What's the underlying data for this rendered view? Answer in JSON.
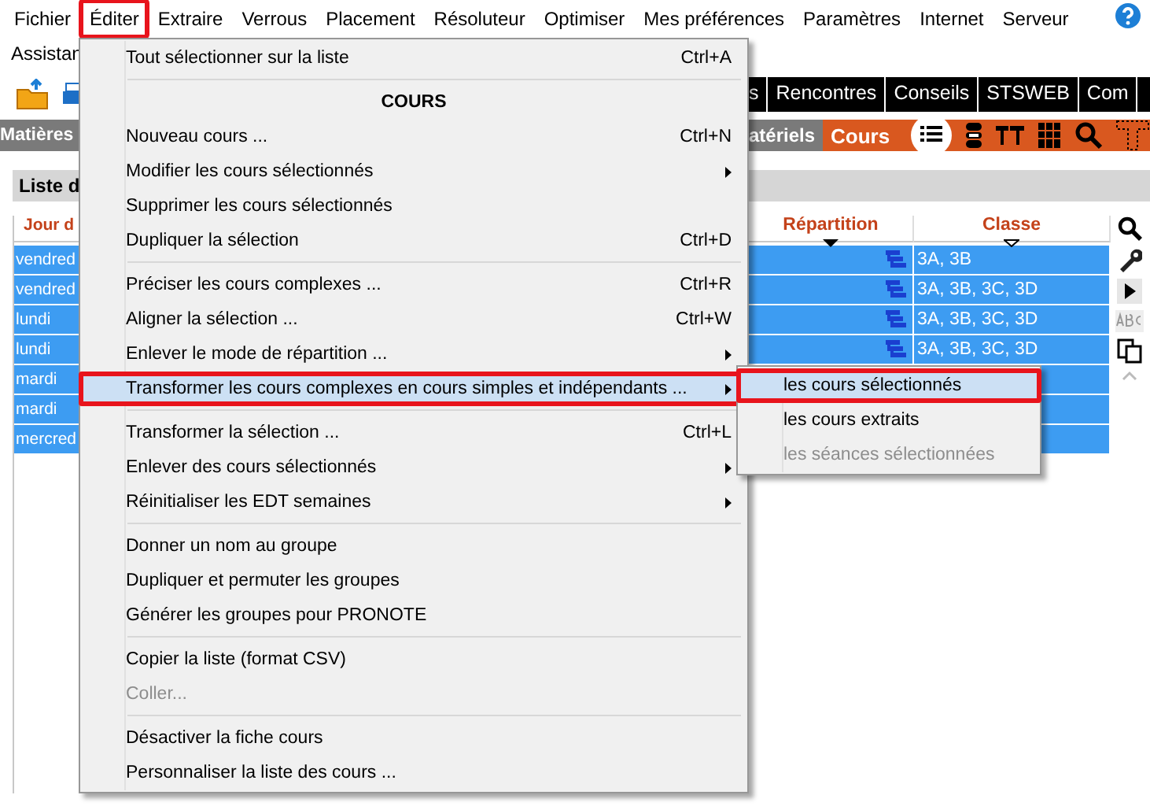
{
  "menubar": [
    {
      "label": "Fichier",
      "selected": false
    },
    {
      "label": "Éditer",
      "selected": true
    },
    {
      "label": "Extraire",
      "selected": false
    },
    {
      "label": "Verrous",
      "selected": false
    },
    {
      "label": "Placement",
      "selected": false
    },
    {
      "label": "Résoluteur",
      "selected": false
    },
    {
      "label": "Optimiser",
      "selected": false
    },
    {
      "label": "Mes préférences",
      "selected": false
    },
    {
      "label": "Paramètres",
      "selected": false
    },
    {
      "label": "Internet",
      "selected": false
    },
    {
      "label": "Serveur",
      "selected": false
    }
  ],
  "menubar_row2": "Assistan",
  "toolbar_tabs": [
    "s",
    "Rencontres",
    "Conseils",
    "STSWEB",
    "Com"
  ],
  "nav_bar": {
    "left": "Matières",
    "items": [
      {
        "label": "atériels",
        "selected": false
      },
      {
        "label": "Cours",
        "selected": true
      }
    ]
  },
  "panel_title": "Liste d",
  "table": {
    "columns": [
      {
        "label": "Jour d",
        "kind": "plain"
      },
      {
        "label": "Répartition",
        "kind": "filled"
      },
      {
        "label": "Classe",
        "kind": "outline"
      }
    ],
    "rows": [
      {
        "day": "vendred",
        "classe": "3A, 3B",
        "selected": true
      },
      {
        "day": "vendred",
        "classe": "3A, 3B, 3C, 3D",
        "selected": true
      },
      {
        "day": "lundi",
        "classe": "3A, 3B, 3C, 3D",
        "selected": true
      },
      {
        "day": "lundi",
        "classe": "3A, 3B, 3C, 3D",
        "selected": true
      },
      {
        "day": "mardi",
        "selected": true
      },
      {
        "day": "mardi",
        "selected": true
      },
      {
        "day": "mercred",
        "selected": true
      }
    ]
  },
  "edit_menu": {
    "items": [
      {
        "kind": "item",
        "label": "Tout sélectionner sur la liste",
        "shortcut": "Ctrl+A",
        "submenu": false,
        "disabled": false,
        "selected": false
      },
      {
        "kind": "separator"
      },
      {
        "kind": "header",
        "label": "COURS"
      },
      {
        "kind": "item",
        "label": "Nouveau cours ...",
        "shortcut": "Ctrl+N",
        "submenu": false,
        "disabled": false,
        "selected": false
      },
      {
        "kind": "item",
        "label": "Modifier les cours sélectionnés",
        "submenu": true,
        "disabled": false,
        "selected": false
      },
      {
        "kind": "item",
        "label": "Supprimer les cours sélectionnés",
        "submenu": false,
        "disabled": false,
        "selected": false
      },
      {
        "kind": "item",
        "label": "Dupliquer la sélection",
        "shortcut": "Ctrl+D",
        "submenu": false,
        "disabled": false,
        "selected": false
      },
      {
        "kind": "separator"
      },
      {
        "kind": "item",
        "label": "Préciser les cours complexes ...",
        "shortcut": "Ctrl+R",
        "submenu": false,
        "disabled": false,
        "selected": false
      },
      {
        "kind": "item",
        "label": "Aligner la sélection ...",
        "shortcut": "Ctrl+W",
        "submenu": false,
        "disabled": false,
        "selected": false
      },
      {
        "kind": "item",
        "label": "Enlever le mode de répartition ...",
        "submenu": true,
        "disabled": false,
        "selected": false
      },
      {
        "kind": "item",
        "label": "Transformer les cours complexes en cours simples et indépendants ...",
        "submenu": true,
        "disabled": false,
        "selected": true
      },
      {
        "kind": "separator"
      },
      {
        "kind": "item",
        "label": "Transformer la sélection ...",
        "shortcut": "Ctrl+L",
        "submenu": false,
        "disabled": false,
        "selected": false
      },
      {
        "kind": "item",
        "label": "Enlever des cours sélectionnés",
        "submenu": true,
        "disabled": false,
        "selected": false
      },
      {
        "kind": "item",
        "label": "Réinitialiser les EDT semaines",
        "submenu": true,
        "disabled": false,
        "selected": false
      },
      {
        "kind": "separator"
      },
      {
        "kind": "item",
        "label": "Donner un nom au groupe",
        "submenu": false,
        "disabled": false,
        "selected": false
      },
      {
        "kind": "item",
        "label": "Dupliquer et permuter les groupes",
        "submenu": false,
        "disabled": false,
        "selected": false
      },
      {
        "kind": "item",
        "label": "Générer les groupes pour PRONOTE",
        "submenu": false,
        "disabled": false,
        "selected": false
      },
      {
        "kind": "separator"
      },
      {
        "kind": "item",
        "label": "Copier la liste (format CSV)",
        "submenu": false,
        "disabled": false,
        "selected": false
      },
      {
        "kind": "item",
        "label": "Coller...",
        "submenu": false,
        "disabled": true,
        "selected": false
      },
      {
        "kind": "separator"
      },
      {
        "kind": "item",
        "label": "Désactiver la fiche cours",
        "submenu": false,
        "disabled": false,
        "selected": false
      },
      {
        "kind": "item",
        "label": "Personnaliser la liste des cours ...",
        "submenu": false,
        "disabled": false,
        "selected": false
      }
    ]
  },
  "submenu": {
    "items": [
      {
        "kind": "item",
        "label": "les cours sélectionnés",
        "submenu": false,
        "disabled": false,
        "selected": true
      },
      {
        "kind": "item",
        "label": "les cours extraits",
        "submenu": false,
        "disabled": false,
        "selected": false
      },
      {
        "kind": "item",
        "label": "les séances sélectionnées",
        "submenu": false,
        "disabled": true,
        "selected": false
      }
    ]
  }
}
